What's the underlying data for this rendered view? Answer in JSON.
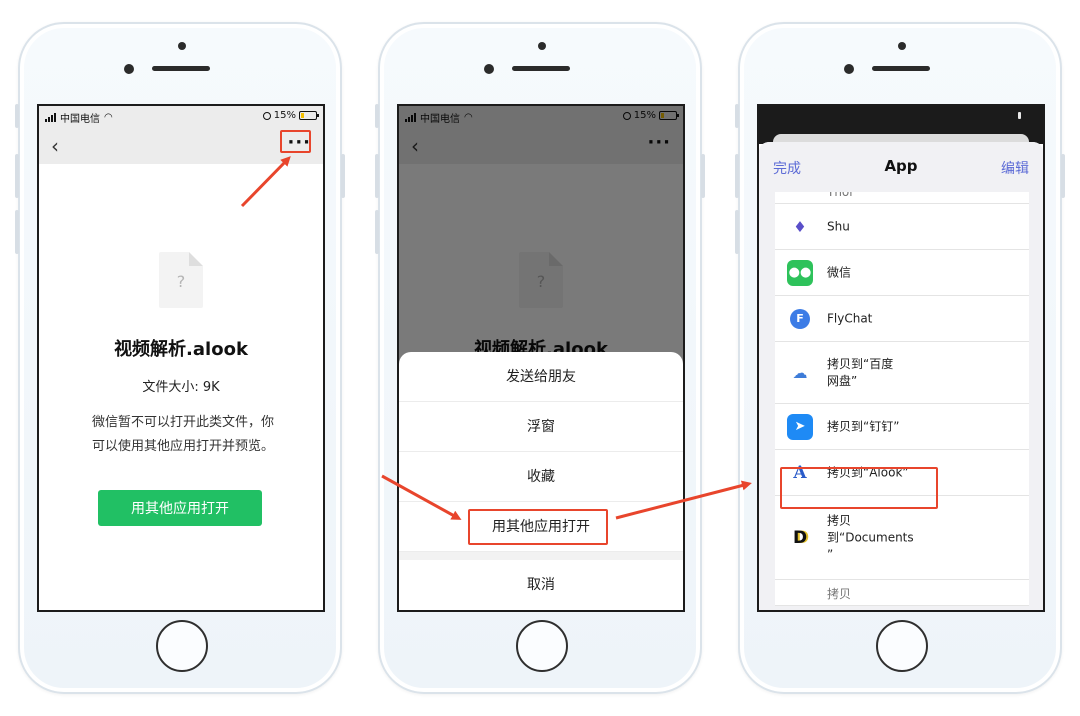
{
  "status": {
    "carrier": "中国电信",
    "battery": "15%"
  },
  "file": {
    "name": "视频解析.alook",
    "size": "文件大小: 9K",
    "message_line1": "微信暂不可以打开此类文件，你",
    "message_line2": "可以使用其他应用打开并预览。",
    "icon_glyph": "?"
  },
  "buttons": {
    "open_with": "用其他应用打开",
    "back_icon": "chevron-left-icon",
    "more_icon": "more-icon"
  },
  "action_sheet": {
    "items": [
      "发送给朋友",
      "浮窗",
      "收藏",
      "用其他应用打开"
    ],
    "cancel": "取消"
  },
  "app_sheet": {
    "done": "完成",
    "title": "App",
    "edit": "编辑",
    "apps": [
      {
        "label": "Thor",
        "icon": "thor-icon",
        "glyph": "⚡"
      },
      {
        "label": "Shu",
        "icon": "shu-icon",
        "glyph": "♦"
      },
      {
        "label": "微信",
        "icon": "wechat-icon",
        "glyph": "●●"
      },
      {
        "label": "FlyChat",
        "icon": "flychat-icon",
        "glyph": "F"
      },
      {
        "label": "拷贝到“百度\n网盘”",
        "icon": "baidu-netdisk-icon",
        "glyph": "☁"
      },
      {
        "label": "拷贝到“钉钉”",
        "icon": "dingtalk-icon",
        "glyph": "➤"
      },
      {
        "label": "拷贝到“Alook”",
        "icon": "alook-icon",
        "glyph": "A"
      },
      {
        "label": "拷贝\n到“Documents\n”",
        "icon": "documents-icon",
        "glyph": "D"
      },
      {
        "label": "拷贝",
        "icon": "app-icon",
        "glyph": ""
      }
    ]
  },
  "colors": {
    "accent_green": "#21c064",
    "highlight_red": "#e8452c",
    "link_blue": "#5c6bd6"
  }
}
